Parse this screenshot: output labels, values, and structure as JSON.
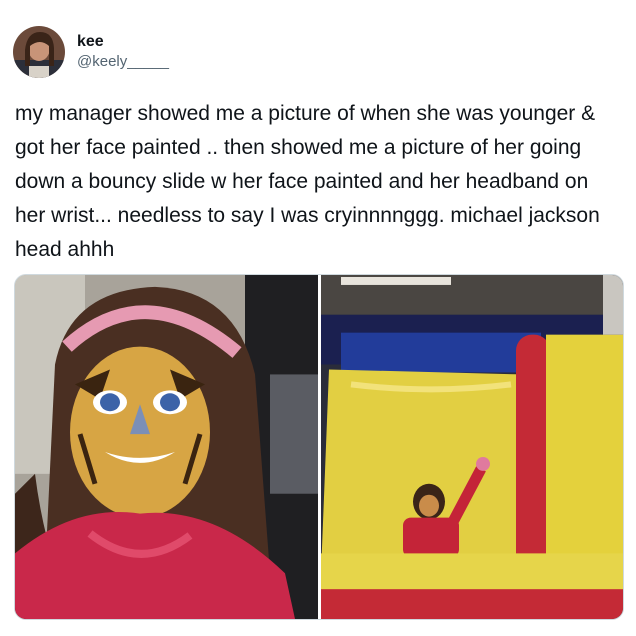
{
  "tweet": {
    "author": {
      "display_name": "kee",
      "handle": "@keely_____",
      "avatar_icon": "user-avatar"
    },
    "text": "my manager showed me a picture of when she was younger & got her face painted .. then showed me a picture of her going down a bouncy slide w her face painted and her headband on her wrist... needless to say I was cryinnnnggg. michael jackson head ahhh",
    "media": [
      {
        "kind": "photo",
        "subject": "face-painted-girl-photo"
      },
      {
        "kind": "photo",
        "subject": "bouncy-slide-photo"
      }
    ]
  }
}
